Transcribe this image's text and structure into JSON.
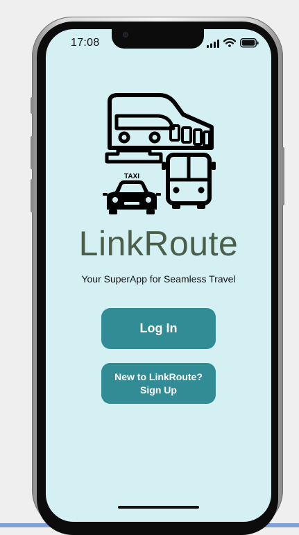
{
  "status_bar": {
    "time": "17:08",
    "icons": [
      "signal-icon",
      "wifi-icon",
      "battery-icon"
    ]
  },
  "logo": {
    "taxi_sign": "TAXI",
    "icons": [
      "train-icon",
      "taxi-icon",
      "bus-icon"
    ]
  },
  "app": {
    "name": "LinkRoute",
    "tagline": "Your SuperApp for Seamless Travel"
  },
  "buttons": {
    "login_label": "Log In",
    "signup_line1": "New to LinkRoute?",
    "signup_line2": "Sign Up"
  },
  "colors": {
    "screen_background": "#d4f0f3",
    "button": "#328c95",
    "brand_text": "#4a5e4a"
  }
}
